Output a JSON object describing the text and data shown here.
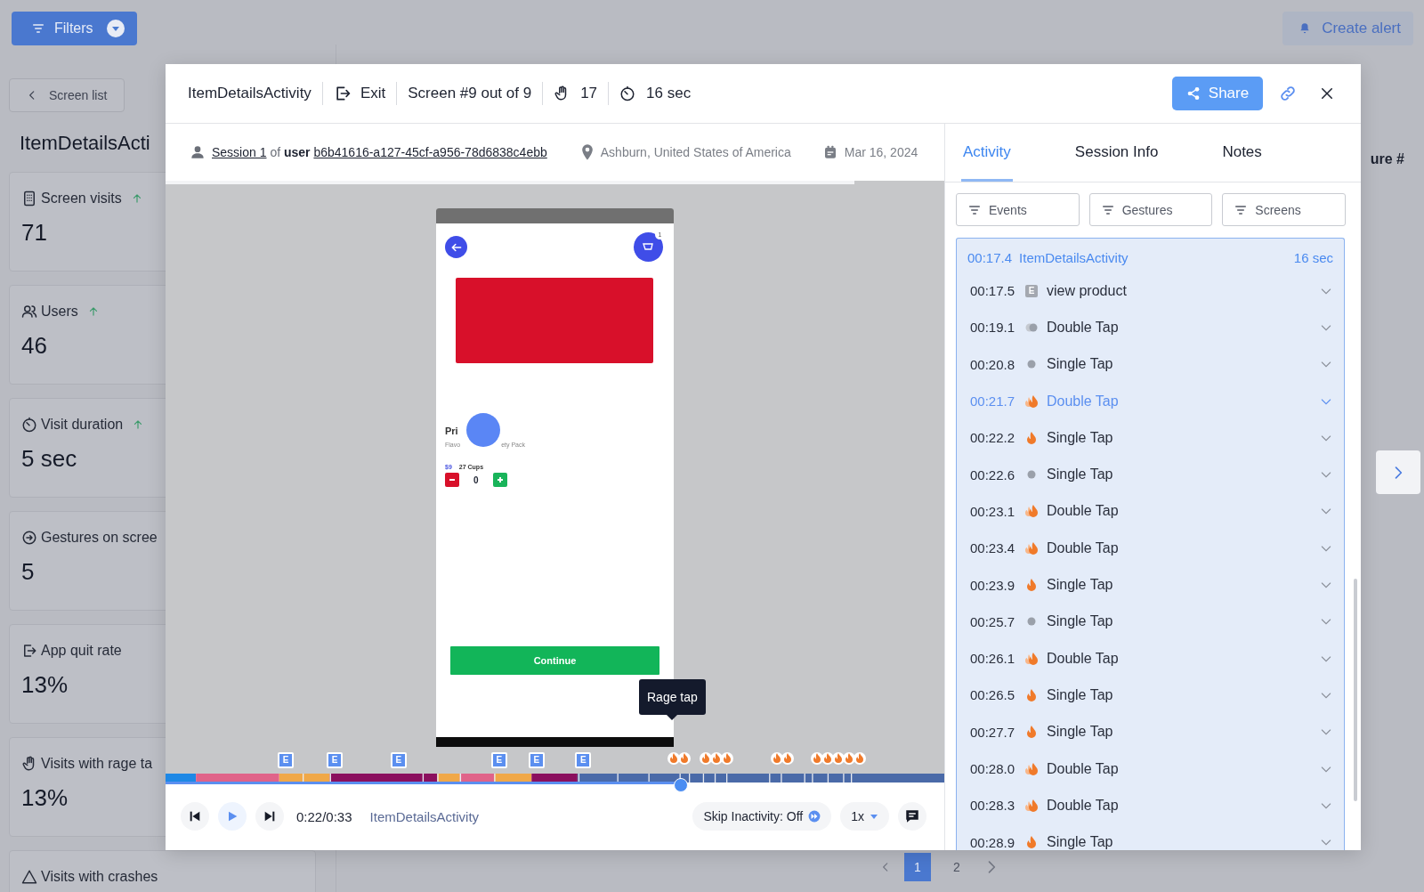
{
  "toolbar": {
    "filters_button": "Filters",
    "create_alert_button": "Create alert"
  },
  "background": {
    "back_button": "Screen list",
    "title": "ItemDetailsActi",
    "metrics": [
      {
        "kind": "screen",
        "label": "Screen visits",
        "trend_up": true,
        "value": "71"
      },
      {
        "kind": "users",
        "label": "Users",
        "trend_up": true,
        "value": "46"
      },
      {
        "kind": "duration",
        "label": "Visit duration",
        "trend_up": true,
        "value": "5 sec"
      },
      {
        "kind": "gestures",
        "label": "Gestures on scree",
        "trend_up": false,
        "value": "5"
      },
      {
        "kind": "quit",
        "label": "App quit rate",
        "trend_up": false,
        "value": "13%"
      },
      {
        "kind": "rage",
        "label": "Visits with rage ta",
        "trend_up": false,
        "value": "13%"
      },
      {
        "kind": "crash",
        "label": "Visits with crashes",
        "trend_up": false
      }
    ],
    "column_heading": "ure #",
    "pages": [
      {
        "label": "1",
        "selected": true
      },
      {
        "label": "2",
        "selected": false
      }
    ]
  },
  "modal": {
    "header": {
      "title": "ItemDetailsActivity",
      "exit": "Exit",
      "screen_position": "Screen #9 out of 9",
      "gestures": "17",
      "duration": "16 sec",
      "share_button": "Share"
    },
    "session": {
      "session_link": "Session 1",
      "of": "of",
      "user": "user",
      "user_id": "b6b41616-a127-45cf-a956-78d6838c4ebb",
      "location": "Ashburn, United States of America",
      "date": "Mar 16, 2024"
    },
    "phone": {
      "cart_badge": "1",
      "product_name": "Pri",
      "subtitle_start": "Flavo",
      "subtitle_end": "ety Pack",
      "price": "$9",
      "size": "27 Cups",
      "quantity": "0",
      "continue_button": "Continue"
    },
    "tooltip": "Rage tap",
    "timeline": {
      "events": [
        "E",
        "E",
        "E",
        "E",
        "E",
        "E"
      ]
    },
    "player": {
      "level": 0.66,
      "time": "0:22/0:33",
      "screen": "ItemDetailsActivity",
      "skip_inactivity": "Skip Inactivity: Off",
      "speed": "1x"
    },
    "tabs": [
      {
        "label": "Activity",
        "selected": true
      },
      {
        "label": "Session Info",
        "selected": false
      },
      {
        "label": "Notes",
        "selected": false
      }
    ],
    "filters": [
      "Events",
      "Gestures",
      "Screens"
    ],
    "activity": {
      "time": "00:17.4",
      "screen": "ItemDetailsActivity",
      "duration": "16 sec",
      "rows": [
        {
          "time": "00:17.5",
          "kind": "event",
          "badge": "E",
          "label": "view product",
          "selected": false
        },
        {
          "time": "00:19.1",
          "kind": "double_tap",
          "label": "Double Tap",
          "selected": false
        },
        {
          "time": "00:20.8",
          "kind": "single_tap",
          "label": "Single Tap",
          "selected": false
        },
        {
          "time": "00:21.7",
          "kind": "rage_double",
          "label": "Double Tap",
          "selected": true
        },
        {
          "time": "00:22.2",
          "kind": "rage_single",
          "label": "Single Tap",
          "selected": false
        },
        {
          "time": "00:22.6",
          "kind": "single_tap",
          "label": "Single Tap",
          "selected": false
        },
        {
          "time": "00:23.1",
          "kind": "rage_double",
          "label": "Double Tap",
          "selected": false
        },
        {
          "time": "00:23.4",
          "kind": "rage_double",
          "label": "Double Tap",
          "selected": false
        },
        {
          "time": "00:23.9",
          "kind": "rage_single",
          "label": "Single Tap",
          "selected": false
        },
        {
          "time": "00:25.7",
          "kind": "single_tap",
          "label": "Single Tap",
          "selected": false
        },
        {
          "time": "00:26.1",
          "kind": "rage_double",
          "label": "Double Tap",
          "selected": false
        },
        {
          "time": "00:26.5",
          "kind": "rage_single",
          "label": "Single Tap",
          "selected": false
        },
        {
          "time": "00:27.7",
          "kind": "rage_single",
          "label": "Single Tap",
          "selected": false
        },
        {
          "time": "00:28.0",
          "kind": "rage_double",
          "label": "Double Tap",
          "selected": false
        },
        {
          "time": "00:28.3",
          "kind": "rage_double",
          "label": "Double Tap",
          "selected": false
        },
        {
          "time": "00:28.9",
          "kind": "rage_single",
          "label": "Single Tap",
          "selected": false
        }
      ]
    }
  }
}
